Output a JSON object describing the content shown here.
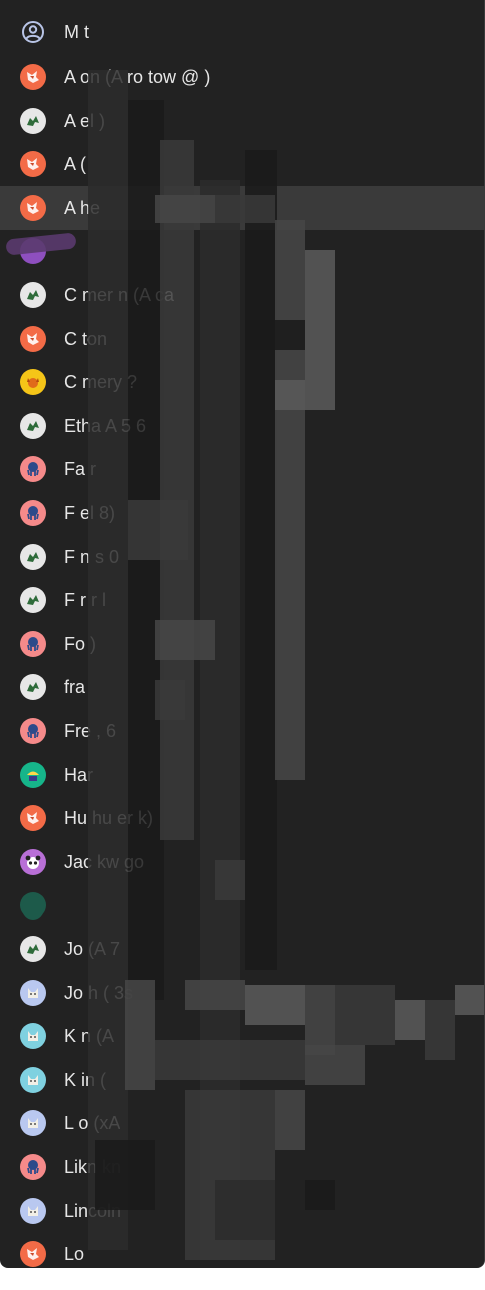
{
  "menu": {
    "header": {
      "label": "M     t",
      "icon": "account-circle-icon"
    },
    "items": [
      {
        "label": "A  on (A     ro  tow     @           )",
        "avatar": "fox",
        "color": "#f36b47"
      },
      {
        "label": "A  el                          )",
        "avatar": "dragon",
        "color": "#e7e7e7"
      },
      {
        "label": "A    (",
        "avatar": "fox",
        "color": "#f36b47"
      },
      {
        "label": "A  he",
        "avatar": "fox",
        "color": "#f36b47"
      },
      {
        "label": "",
        "avatar": "purple",
        "color": "#8e4fbf"
      },
      {
        "label": "C  mer  n (A    ca",
        "avatar": "dragon",
        "color": "#e7e7e7"
      },
      {
        "label": "C  ton",
        "avatar": "fox",
        "color": "#f36b47"
      },
      {
        "label": "C  mery    ?",
        "avatar": "dog",
        "color": "#f5c518"
      },
      {
        "label": "Etha   A       5      6",
        "avatar": "dragon",
        "color": "#e7e7e7"
      },
      {
        "label": "Fa          r",
        "avatar": "octopus",
        "color": "#f58a8a"
      },
      {
        "label": "F  el              8)",
        "avatar": "octopus",
        "color": "#f58a8a"
      },
      {
        "label": "F  n          s       0",
        "avatar": "dragon",
        "color": "#e7e7e7"
      },
      {
        "label": "F  r             r   l",
        "avatar": "dragon",
        "color": "#e7e7e7"
      },
      {
        "label": "Fo                         )",
        "avatar": "octopus",
        "color": "#f58a8a"
      },
      {
        "label": "fra",
        "avatar": "dragon",
        "color": "#e7e7e7"
      },
      {
        "label": "Fre  ,                  6",
        "avatar": "octopus",
        "color": "#f58a8a"
      },
      {
        "label": "Har",
        "avatar": "construction",
        "color": "#16b58a"
      },
      {
        "label": "Hu                hu   er      k)",
        "avatar": "fox",
        "color": "#f36b47"
      },
      {
        "label": "Jac        kw    go",
        "avatar": "panda",
        "color": "#b86fd6"
      },
      {
        "label": "",
        "avatar": "green",
        "color": "#1d5a4a"
      },
      {
        "label": "Jo   (A  7",
        "avatar": "dragon",
        "color": "#e7e7e7"
      },
      {
        "label": "Jo   h (  3s",
        "avatar": "cat",
        "color": "#b9c8f0"
      },
      {
        "label": "K   n (A",
        "avatar": "cat",
        "color": "#7fd1e0"
      },
      {
        "label": "K  in (",
        "avatar": "cat",
        "color": "#7fd1e0"
      },
      {
        "label": "L  o (xA",
        "avatar": "cat",
        "color": "#b9c8f0"
      },
      {
        "label": "Likn     kn",
        "avatar": "octopus",
        "color": "#f58a8a"
      },
      {
        "label": "Lincoln",
        "avatar": "cat",
        "color": "#b9c8f0"
      },
      {
        "label": "Lo",
        "avatar": "fox",
        "color": "#f36b47"
      }
    ]
  }
}
